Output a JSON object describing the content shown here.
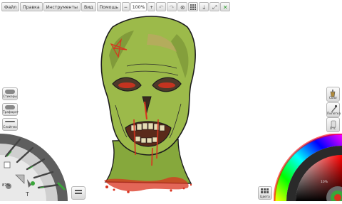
{
  "menu": {
    "file": "Файл",
    "edit": "Правка",
    "tools": "Инструменты",
    "view": "Вид",
    "help": "Помощь"
  },
  "toolbar": {
    "zoom_out": "−",
    "zoom_value": "100%",
    "zoom_in": "+"
  },
  "left_tools": {
    "stickers": "Стикеры",
    "tracing": "Трафарет",
    "layers": "Слойтмо"
  },
  "right_tools": {
    "color": "Color",
    "sample": "Пипетка",
    "opacity": "Отс."
  },
  "bottom": {
    "colors_label": "Цвета",
    "opacity_value": "87%",
    "size_value": "10%"
  },
  "colors": {
    "skin": "#9cba4a",
    "skin_dark": "#6e8a2e",
    "blood": "#d9331f",
    "accent": "#3aa63a"
  }
}
